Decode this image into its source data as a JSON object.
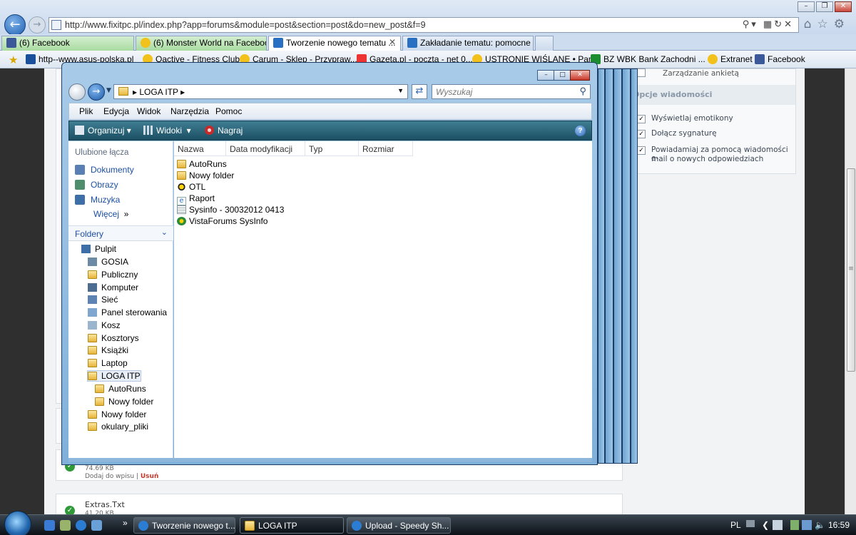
{
  "browser": {
    "url": "http://www.fixitpc.pl/index.php?app=forums&module=post&section=post&do=new_post&f=9",
    "tabs": [
      {
        "label": "(6) Facebook"
      },
      {
        "label": "(6) Monster World na Faceboo..."
      },
      {
        "label": "Tworzenie nowego tematu ..."
      },
      {
        "label": "Zakładanie tematu: pomocne ..."
      }
    ],
    "favorites": [
      {
        "label": "http--www.asus-polska.pl"
      },
      {
        "label": "Oactive - Fitness Club"
      },
      {
        "label": "Carum - Sklep - Przypraw..."
      },
      {
        "label": "Gazeta.pl - poczta - net 0..."
      },
      {
        "label": "USTRONIE WIŚLANE • Pan..."
      },
      {
        "label": "BZ WBK  Bank Zachodni ..."
      },
      {
        "label": "Extranet"
      },
      {
        "label": "Facebook"
      }
    ]
  },
  "forum": {
    "poll_label": "Zarządzanie ankietą",
    "options_title": "Opcje wiadomości",
    "options": [
      {
        "label": "Wyświetlaj emotikony",
        "checked": true
      },
      {
        "label": "Dołącz sygnaturę",
        "checked": true
      },
      {
        "label": "Powiadamiaj za pomocą wiadomości e-",
        "label2": "mail o nowych odpowiedziach",
        "checked": true
      }
    ],
    "attachments": [
      {
        "name": "",
        "size": "74.69 KB",
        "add_link": "Dodaj do wpisu",
        "sep": "|",
        "del_link": "Usuń"
      },
      {
        "name": "Extras.Txt",
        "size": "41.20 KB"
      }
    ]
  },
  "explorer": {
    "breadcrumb": "LOGA ITP",
    "search_placeholder": "Wyszukaj",
    "menu": [
      "Plik",
      "Edycja",
      "Widok",
      "Narzędzia",
      "Pomoc"
    ],
    "commands": [
      "Organizuj",
      "Widoki",
      "Nagraj"
    ],
    "favorites_title": "Ulubione łącza",
    "favorite_links": [
      "Dokumenty",
      "Obrazy",
      "Muzyka",
      "Więcej"
    ],
    "more_arrow": "»",
    "folders_title": "Foldery",
    "tree": [
      {
        "label": "Pulpit"
      },
      {
        "label": "GOSIA"
      },
      {
        "label": "Publiczny"
      },
      {
        "label": "Komputer"
      },
      {
        "label": "Sieć"
      },
      {
        "label": "Panel sterowania"
      },
      {
        "label": "Kosz"
      },
      {
        "label": "Kosztorys"
      },
      {
        "label": "Książki"
      },
      {
        "label": "Laptop"
      },
      {
        "label": "LOGA ITP"
      },
      {
        "label": "AutoRuns"
      },
      {
        "label": "Nowy folder"
      },
      {
        "label": "Nowy folder"
      },
      {
        "label": "okulary_pliki"
      }
    ],
    "columns": [
      "Nazwa",
      "Data modyfikacji",
      "Typ",
      "Rozmiar"
    ],
    "files": [
      {
        "name": "AutoRuns",
        "icon": "folder-icon"
      },
      {
        "name": "Nowy folder",
        "icon": "folder-icon"
      },
      {
        "name": "OTL",
        "icon": "otl-app-icon"
      },
      {
        "name": "Raport",
        "icon": "ie-document-icon"
      },
      {
        "name": "Sysinfo - 30032012 0413",
        "icon": "text-document-icon"
      },
      {
        "name": "VistaForums SysInfo",
        "icon": "sysinfo-app-icon"
      }
    ]
  },
  "taskbar": {
    "buttons": [
      {
        "label": "Tworzenie nowego t..."
      },
      {
        "label": "LOGA ITP"
      },
      {
        "label": "Upload - Speedy Sh..."
      }
    ],
    "chevron": "»",
    "lang": "PL",
    "clock": "16:59"
  },
  "colors": {
    "accent": "#1e50a2",
    "cmdbar": "#2b6678",
    "taskbar": "#1b2229"
  }
}
